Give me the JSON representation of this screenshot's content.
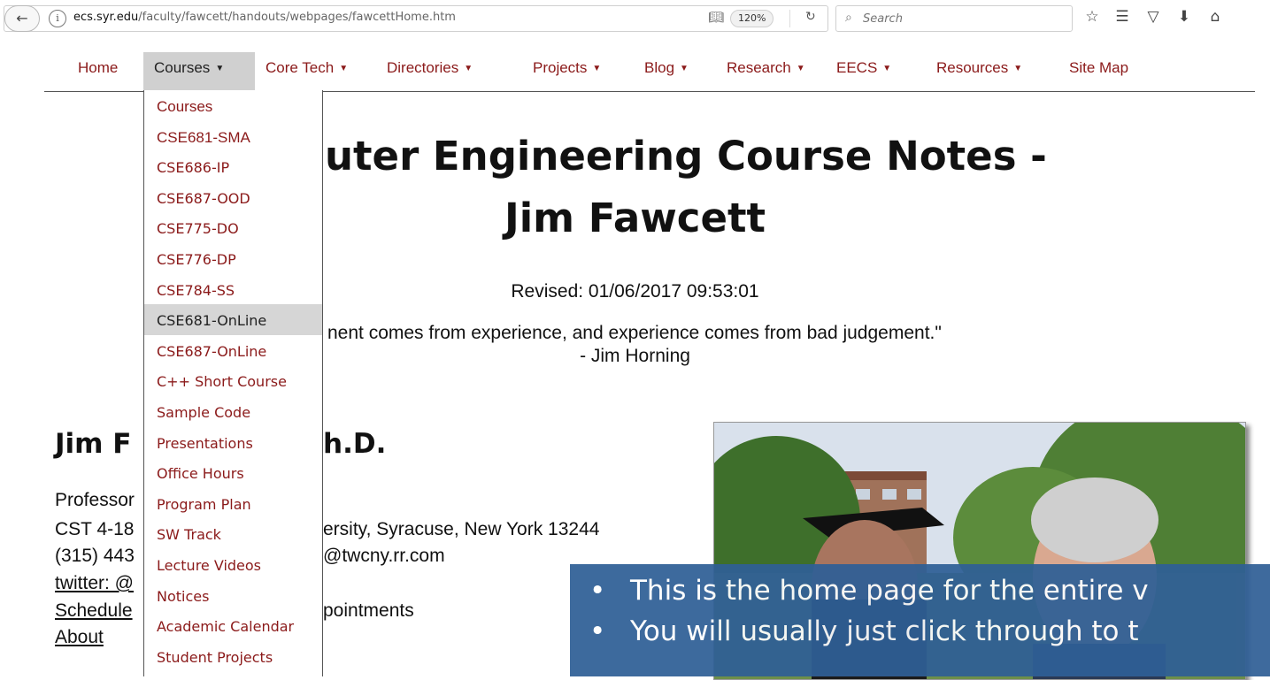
{
  "browser": {
    "url_domain": "ecs.syr.edu",
    "url_path": "/faculty/fawcett/handouts/webpages/fawcettHome.htm",
    "zoom": "120%",
    "search_placeholder": "Search",
    "icons": [
      "back-arrow-icon",
      "info-icon",
      "reader-view-icon",
      "reload-icon",
      "search-icon",
      "bookmark-star-icon",
      "library-icon",
      "pocket-icon",
      "download-icon",
      "home-icon"
    ]
  },
  "nav": {
    "items": [
      {
        "label": "Home",
        "dropdown": false
      },
      {
        "label": "Courses",
        "dropdown": true
      },
      {
        "label": "Core Tech",
        "dropdown": true
      },
      {
        "label": "Directories",
        "dropdown": true
      },
      {
        "label": "Projects",
        "dropdown": true
      },
      {
        "label": "Blog",
        "dropdown": true
      },
      {
        "label": "Research",
        "dropdown": true
      },
      {
        "label": "EECS",
        "dropdown": true
      },
      {
        "label": "Resources",
        "dropdown": true
      },
      {
        "label": "Site Map",
        "dropdown": false
      }
    ],
    "active": "Courses",
    "caret": "▼",
    "accent_color": "#8b1a1a"
  },
  "courses_menu": {
    "items": [
      "Courses",
      "CSE681-SMA",
      "CSE686-IP",
      "CSE687-OOD",
      "CSE775-DO",
      "CSE776-DP",
      "CSE784-SS",
      "CSE681-OnLine",
      "CSE687-OnLine",
      "C++ Short Course",
      "Sample Code",
      "Presentations",
      "Office Hours",
      "Program Plan",
      "SW Track",
      "Lecture Videos",
      "Notices",
      "Academic Calendar",
      "Student Projects"
    ],
    "hovered": "CSE681-OnLine"
  },
  "page": {
    "title_line1": "uter Engineering Course Notes -",
    "title_line2": "Jim Fawcett",
    "revised": "Revised: 01/06/2017 09:53:01",
    "quote_line1": "nent comes from experience, and experience comes from bad judgement.\"",
    "quote_line2": "- Jim Horning",
    "profile_name_left": "Jim F",
    "profile_name_right": "h.D.",
    "info": [
      {
        "left": "Professor",
        "right": ""
      },
      {
        "left": "CST 4-18",
        "right": "ersity, Syracuse, New York 13244"
      },
      {
        "left": "(315) 443",
        "right": "@twcny.rr.com"
      },
      {
        "left": "twitter: @",
        "right": "",
        "link": true
      },
      {
        "left": "Schedule",
        "right": "pointments",
        "link": true
      },
      {
        "left": "About",
        "right": "",
        "link": true
      }
    ]
  },
  "slide_overlay": {
    "bullets": [
      "This is the home page for the entire v",
      "You will usually just click through to t"
    ],
    "color": "#2f5f96"
  }
}
